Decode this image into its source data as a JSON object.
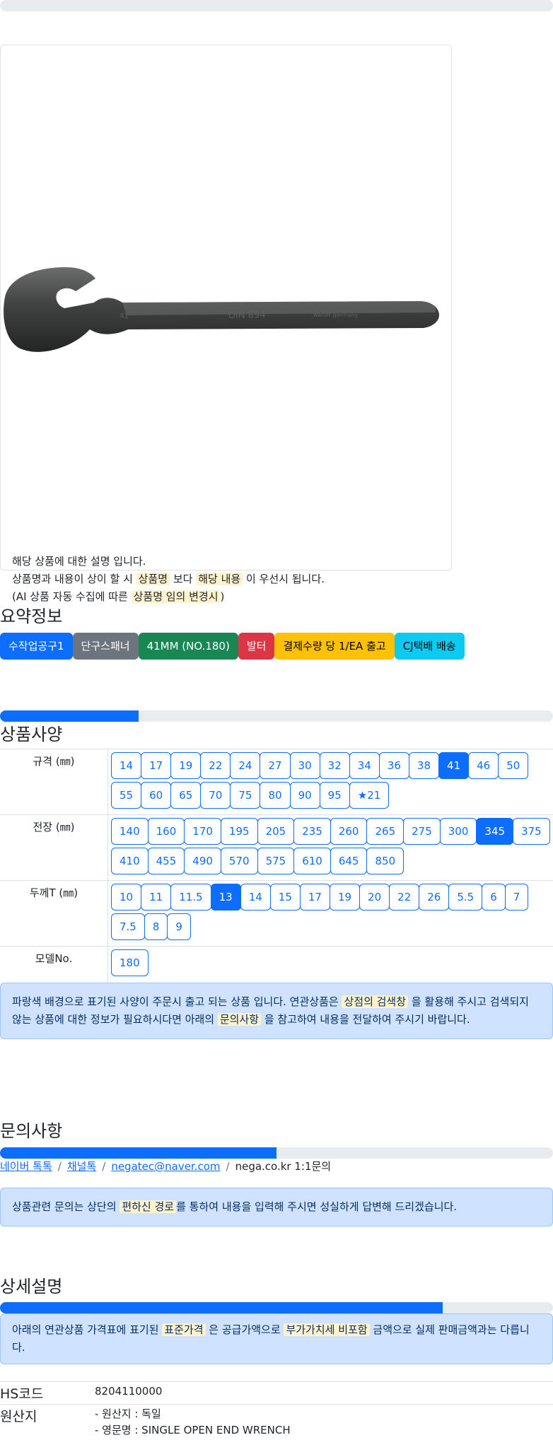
{
  "product_card": {
    "image_name": "wrench-image",
    "desc_line1": "해당 상품에 대한 설명 입니다.",
    "desc_line2_pre": "상품명과 내용이 상이 할 시",
    "desc_line2_hl1": "상품명",
    "desc_line2_mid": "보다",
    "desc_line2_hl2": "해당 내용",
    "desc_line2_post": "이 우선시 됩니다.",
    "desc_line3_pre": "(AI 상품 자동 수집에 따른",
    "desc_line3_hl": "상품명 임의 변경시",
    "desc_line3_post": ")"
  },
  "summary": {
    "title": "요약정보",
    "badges": [
      "수작업공구1",
      "단구스패너",
      "41MM (NO.180)",
      "발터",
      "결제수량 당 1/EA 출고",
      "CJ택배 배송"
    ]
  },
  "specs": {
    "title": "상품사양",
    "progress": 0.25,
    "rows": [
      {
        "label": "규격 (㎜)",
        "options": [
          "14",
          "17",
          "19",
          "22",
          "24",
          "27",
          "30",
          "32",
          "34",
          "36",
          "38",
          "41",
          "46",
          "50",
          "55",
          "60",
          "65",
          "70",
          "75",
          "80",
          "90",
          "95",
          "★21"
        ],
        "selected": "41"
      },
      {
        "label": "전장 (㎜)",
        "options": [
          "140",
          "160",
          "170",
          "195",
          "205",
          "235",
          "260",
          "265",
          "275",
          "300",
          "345",
          "375",
          "410",
          "455",
          "490",
          "570",
          "575",
          "610",
          "645",
          "850"
        ],
        "selected": "345"
      },
      {
        "label": "두께T (㎜)",
        "options": [
          "10",
          "11",
          "11.5",
          "13",
          "14",
          "15",
          "17",
          "19",
          "20",
          "22",
          "26",
          "5.5",
          "6",
          "7",
          "7.5",
          "8",
          "9"
        ],
        "selected": "13"
      },
      {
        "label": "모델No.",
        "options": [
          "180"
        ],
        "selected": ""
      }
    ],
    "notice_pre": "파랑색 배경으로 표기된 사양이 주문시 출고 되는 상품 입니다. 연관상품은",
    "notice_hl1": "상점의 검색창",
    "notice_mid": "을 활용해 주시고 검색되지 않는 상품에 대한 정보가 필요하시다면 아래의",
    "notice_hl2": "문의사항",
    "notice_post": "을 참고하여 내용을 전달하여 주시기 바랍니다."
  },
  "inquiry": {
    "title": "문의사항",
    "progress": 0.5,
    "links": [
      "네이버 톡톡",
      "채널톡",
      "negatec@naver.com"
    ],
    "plain": "nega.co.kr 1:1문의",
    "notice_pre": "상품관련 문의는 상단의",
    "notice_hl": "편하신 경로",
    "notice_post": "를 통하여 내용을 입력해 주시면 성실하게 답변해 드리겠습니다."
  },
  "detail": {
    "title": "상세설명",
    "progress": 0.8,
    "notice_pre": "아래의 연관상품 가격표에 표기된",
    "notice_hl1": "표준가격",
    "notice_mid": "은 공급가액으로",
    "notice_hl2": "부가가치세 비포함",
    "notice_post": "금액으로 실제 판매금액과는 다릅니다."
  },
  "info": {
    "hs_label": "HS코드",
    "hs_value": "8204110000",
    "origin_label": "원산지",
    "origin_line1": "- 원산지 : 독일",
    "origin_line2": "- 영문명 : SINGLE OPEN END WRENCH"
  },
  "colors": {
    "primary": "#0d6efd",
    "highlight": "#fff3cd",
    "alert_bg": "#cfe2ff",
    "progress_track": "#e9ecef"
  }
}
